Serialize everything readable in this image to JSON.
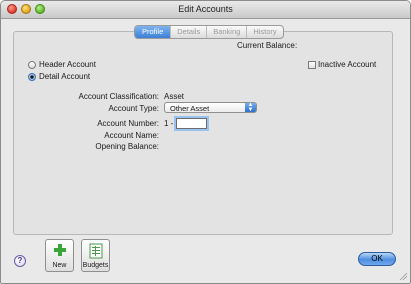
{
  "window": {
    "title": "Edit Accounts"
  },
  "tabs": [
    {
      "label": "Profile",
      "active": true
    },
    {
      "label": "Details",
      "active": false
    },
    {
      "label": "Banking",
      "active": false
    },
    {
      "label": "History",
      "active": false
    }
  ],
  "profile": {
    "current_balance_label": "Current Balance",
    "current_balance_value": ":",
    "header_account_label": "Header Account",
    "detail_account_label": "Detail Account",
    "detail_account_selected": true,
    "inactive_account_label": "Inactive Account",
    "inactive_account_checked": false,
    "classification_label": "Account Classification:",
    "classification_value": "Asset",
    "type_label": "Account Type:",
    "type_value": "Other Asset",
    "number_label": "Account Number:",
    "number_prefix": "1 -",
    "number_value": "",
    "name_label": "Account Name:",
    "opening_balance_label": "Opening Balance:"
  },
  "footer": {
    "help_icon": "?",
    "new_label": "New",
    "budgets_label": "Budgets",
    "ok_label": "OK"
  },
  "colors": {
    "tab_active": "#3b7fd4",
    "ok_button": "#4f8ee0",
    "new_plus": "#3aa63a"
  }
}
